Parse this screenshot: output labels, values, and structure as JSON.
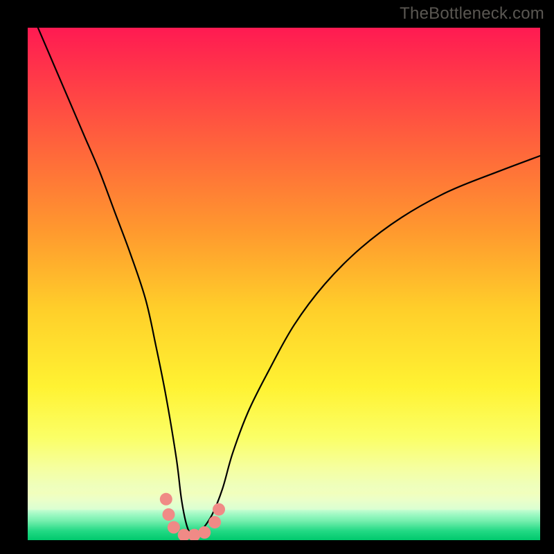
{
  "watermark": "TheBottleneck.com",
  "chart_data": {
    "type": "line",
    "title": "",
    "xlabel": "",
    "ylabel": "",
    "xlim": [
      0,
      100
    ],
    "ylim": [
      0,
      100
    ],
    "grid": false,
    "series": [
      {
        "name": "bottleneck-curve",
        "x": [
          2,
          5,
          8,
          11,
          14,
          17,
          20,
          23,
          25,
          27,
          29,
          30,
          31,
          32,
          33,
          34,
          36,
          38,
          40,
          43,
          47,
          52,
          58,
          65,
          73,
          82,
          92,
          100
        ],
        "values": [
          100,
          93,
          86,
          79,
          72,
          64,
          56,
          47,
          38,
          28,
          16,
          8,
          3,
          1,
          1,
          2,
          5,
          10,
          17,
          25,
          33,
          42,
          50,
          57,
          63,
          68,
          72,
          75
        ]
      }
    ],
    "markers": {
      "name": "trough-markers",
      "color": "#f08a86",
      "radius_px": 9,
      "points": [
        {
          "x": 27,
          "y": 8
        },
        {
          "x": 27.5,
          "y": 5
        },
        {
          "x": 28.5,
          "y": 2.5
        },
        {
          "x": 30.5,
          "y": 1
        },
        {
          "x": 32.5,
          "y": 1
        },
        {
          "x": 34.5,
          "y": 1.5
        },
        {
          "x": 36.5,
          "y": 3.5
        },
        {
          "x": 37.3,
          "y": 6
        }
      ]
    },
    "background": {
      "type": "vertical-gradient",
      "stops": [
        {
          "pos": 0.0,
          "color": "#ff1a52"
        },
        {
          "pos": 0.25,
          "color": "#ff6a3a"
        },
        {
          "pos": 0.55,
          "color": "#ffcf2a"
        },
        {
          "pos": 0.8,
          "color": "#fbff66"
        },
        {
          "pos": 0.92,
          "color": "#eaffd0"
        },
        {
          "pos": 1.0,
          "color": "#00e37a"
        }
      ]
    }
  }
}
